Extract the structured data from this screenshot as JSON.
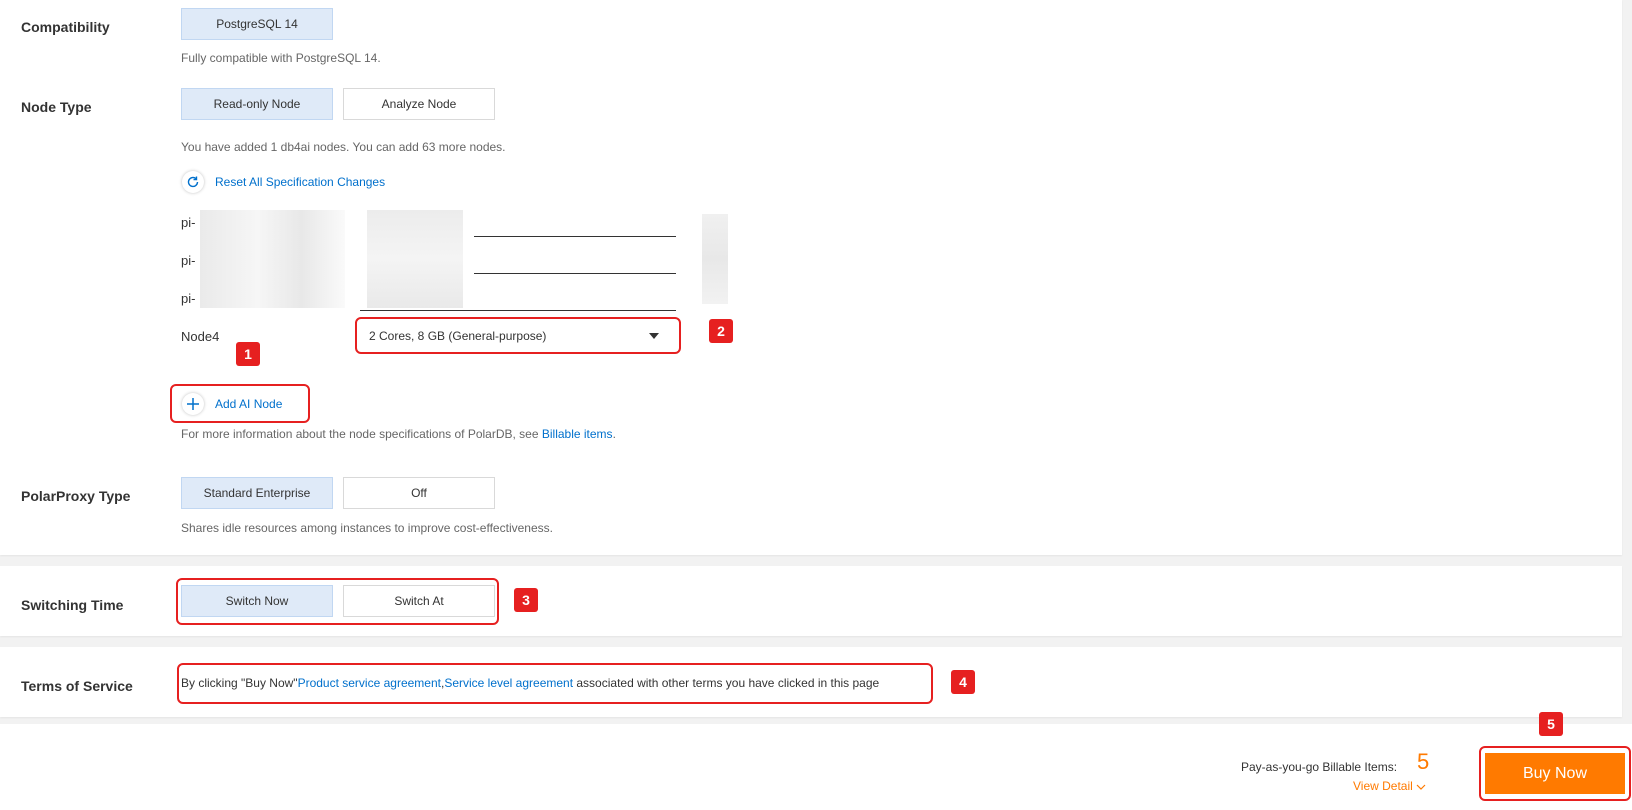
{
  "compatibility": {
    "label": "Compatibility",
    "option": "PostgreSQL 14",
    "hint": "Fully compatible with PostgreSQL 14."
  },
  "node_type": {
    "label": "Node Type",
    "options": [
      "Read-only Node",
      "Analyze Node"
    ],
    "hint": "You have added 1 db4ai nodes. You can add 63 more nodes.",
    "reset_label": "Reset All Specification Changes",
    "nodes": [
      {
        "name": "pi-"
      },
      {
        "name": "pi-"
      },
      {
        "name": "pi-"
      },
      {
        "name": "Node4",
        "spec": "2 Cores, 8 GB (General-purpose)"
      }
    ],
    "add_label": "Add AI Node",
    "info_prefix": "For more information about the node specifications of PolarDB, see ",
    "info_link": "Billable items",
    "info_suffix": "."
  },
  "proxy": {
    "label": "PolarProxy Type",
    "options": [
      "Standard Enterprise",
      "Off"
    ],
    "hint": "Shares idle resources among instances to improve cost-effectiveness."
  },
  "switching": {
    "label": "Switching Time",
    "options": [
      "Switch Now",
      "Switch At"
    ]
  },
  "terms": {
    "label": "Terms of Service",
    "prefix": "By clicking \"Buy Now\"",
    "link1": "Product service agreement",
    "sep": ",",
    "link2": "Service level agreement",
    "suffix": " associated with other terms you have clicked in this page"
  },
  "footer": {
    "billable_label": "Pay-as-you-go Billable Items:",
    "billable_count": "5",
    "view_detail": "View Detail",
    "buy_label": "Buy Now"
  },
  "badges": [
    "1",
    "2",
    "3",
    "4",
    "5"
  ],
  "colors": {
    "accent": "#0070cc",
    "buy": "#ff7a00",
    "highlight": "#e62020",
    "selected_bg": "#dfeaf8"
  }
}
